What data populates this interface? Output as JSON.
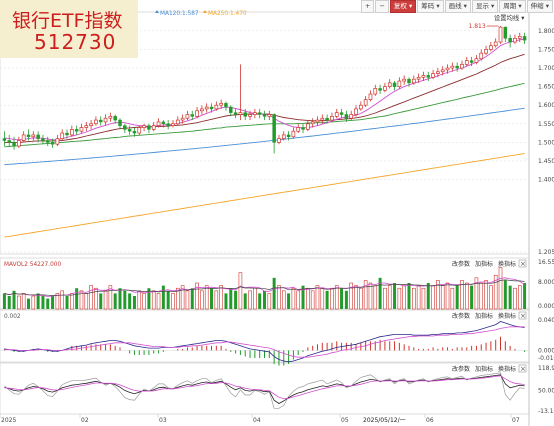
{
  "title": {
    "name": "银行ETF指数",
    "code": "512730"
  },
  "toolbar": [
    "+",
    "−",
    "复权",
    "筹码",
    "画线",
    "显示",
    "周期",
    "伸缩"
  ],
  "toolbar_active": 2,
  "settings_label": "设置均线",
  "ma_legend": [
    {
      "text": "1.644",
      "color": "#3c7ac4"
    },
    {
      "text": "MA120:1.587",
      "color": "#4a8fd6"
    },
    {
      "text": "MA250:1.470",
      "color": "#f5a52a"
    }
  ],
  "price_axis": [
    "1.800",
    "1.750",
    "1.700",
    "1.650",
    "1.600",
    "1.550",
    "1.500",
    "1.450",
    "1.400",
    "1.205"
  ],
  "high_marker": "1.813",
  "vol_title": "MAVOL2 54227.000",
  "vol_axis": [
    "16.555",
    "8.000",
    "0.000"
  ],
  "macd_title": "0.002",
  "macd_axis": [
    "0.040",
    "0.000",
    "-0.010"
  ],
  "kdj_axis": [
    "118.93",
    "50.00",
    "-13.160"
  ],
  "panel_buttons": [
    "改参数",
    "加指标",
    "换指标"
  ],
  "close_glyph": "×",
  "x_axis": [
    "2025",
    "02",
    "03",
    "04",
    "05",
    "2025/05/12/一",
    "06",
    "07"
  ],
  "colors": {
    "up": "#d0342c",
    "down": "#239a2c",
    "bg": "#ffffff"
  },
  "chart_data": {
    "type": "candlestick",
    "indicators": [
      "MA120",
      "MA250",
      "MAVOL2",
      "MACD",
      "KDJ"
    ],
    "ylim": [
      1.205,
      1.84
    ],
    "high_label": 1.813,
    "candles": [
      [
        1.51,
        1.505,
        1.53,
        1.49
      ],
      [
        1.505,
        1.5,
        1.52,
        1.49
      ],
      [
        1.5,
        1.49,
        1.515,
        1.48
      ],
      [
        1.49,
        1.505,
        1.515,
        1.485
      ],
      [
        1.505,
        1.52,
        1.53,
        1.5
      ],
      [
        1.52,
        1.515,
        1.535,
        1.505
      ],
      [
        1.515,
        1.52,
        1.53,
        1.505
      ],
      [
        1.52,
        1.51,
        1.53,
        1.5
      ],
      [
        1.51,
        1.505,
        1.52,
        1.495
      ],
      [
        1.505,
        1.5,
        1.515,
        1.49
      ],
      [
        1.5,
        1.495,
        1.51,
        1.485
      ],
      [
        1.495,
        1.51,
        1.52,
        1.49
      ],
      [
        1.51,
        1.525,
        1.535,
        1.505
      ],
      [
        1.525,
        1.52,
        1.535,
        1.51
      ],
      [
        1.52,
        1.535,
        1.545,
        1.515
      ],
      [
        1.535,
        1.53,
        1.545,
        1.52
      ],
      [
        1.53,
        1.54,
        1.55,
        1.525
      ],
      [
        1.54,
        1.545,
        1.555,
        1.53
      ],
      [
        1.545,
        1.55,
        1.56,
        1.535
      ],
      [
        1.55,
        1.56,
        1.57,
        1.545
      ],
      [
        1.56,
        1.555,
        1.57,
        1.545
      ],
      [
        1.555,
        1.565,
        1.575,
        1.545
      ],
      [
        1.565,
        1.57,
        1.58,
        1.555
      ],
      [
        1.57,
        1.56,
        1.575,
        1.55
      ],
      [
        1.56,
        1.545,
        1.565,
        1.535
      ],
      [
        1.545,
        1.535,
        1.55,
        1.525
      ],
      [
        1.535,
        1.53,
        1.545,
        1.52
      ],
      [
        1.53,
        1.525,
        1.54,
        1.515
      ],
      [
        1.525,
        1.54,
        1.545,
        1.52
      ],
      [
        1.54,
        1.545,
        1.55,
        1.53
      ],
      [
        1.545,
        1.535,
        1.55,
        1.525
      ],
      [
        1.535,
        1.545,
        1.555,
        1.53
      ],
      [
        1.545,
        1.555,
        1.565,
        1.54
      ],
      [
        1.555,
        1.55,
        1.56,
        1.54
      ],
      [
        1.55,
        1.545,
        1.56,
        1.535
      ],
      [
        1.545,
        1.55,
        1.56,
        1.54
      ],
      [
        1.55,
        1.56,
        1.57,
        1.545
      ],
      [
        1.56,
        1.565,
        1.575,
        1.55
      ],
      [
        1.565,
        1.575,
        1.585,
        1.56
      ],
      [
        1.575,
        1.57,
        1.585,
        1.56
      ],
      [
        1.57,
        1.585,
        1.595,
        1.565
      ],
      [
        1.585,
        1.59,
        1.6,
        1.575
      ],
      [
        1.59,
        1.595,
        1.605,
        1.58
      ],
      [
        1.595,
        1.59,
        1.605,
        1.58
      ],
      [
        1.59,
        1.6,
        1.61,
        1.585
      ],
      [
        1.6,
        1.605,
        1.615,
        1.59
      ],
      [
        1.605,
        1.595,
        1.61,
        1.585
      ],
      [
        1.595,
        1.58,
        1.6,
        1.57
      ],
      [
        1.58,
        1.575,
        1.59,
        1.565
      ],
      [
        1.575,
        1.58,
        1.71,
        1.56
      ],
      [
        1.58,
        1.57,
        1.59,
        1.56
      ],
      [
        1.57,
        1.575,
        1.585,
        1.56
      ],
      [
        1.575,
        1.58,
        1.59,
        1.565
      ],
      [
        1.58,
        1.575,
        1.59,
        1.565
      ],
      [
        1.575,
        1.57,
        1.585,
        1.56
      ],
      [
        1.57,
        1.575,
        1.585,
        1.56
      ],
      [
        1.575,
        1.5,
        1.578,
        1.47
      ],
      [
        1.5,
        1.51,
        1.52,
        1.495
      ],
      [
        1.51,
        1.52,
        1.53,
        1.505
      ],
      [
        1.52,
        1.515,
        1.53,
        1.505
      ],
      [
        1.515,
        1.53,
        1.54,
        1.51
      ],
      [
        1.53,
        1.54,
        1.55,
        1.525
      ],
      [
        1.54,
        1.535,
        1.55,
        1.525
      ],
      [
        1.535,
        1.55,
        1.56,
        1.53
      ],
      [
        1.55,
        1.555,
        1.565,
        1.54
      ],
      [
        1.555,
        1.56,
        1.57,
        1.545
      ],
      [
        1.56,
        1.565,
        1.575,
        1.55
      ],
      [
        1.565,
        1.56,
        1.575,
        1.55
      ],
      [
        1.56,
        1.57,
        1.58,
        1.555
      ],
      [
        1.57,
        1.58,
        1.59,
        1.565
      ],
      [
        1.58,
        1.575,
        1.59,
        1.565
      ],
      [
        1.575,
        1.565,
        1.585,
        1.555
      ],
      [
        1.565,
        1.575,
        1.585,
        1.56
      ],
      [
        1.575,
        1.59,
        1.6,
        1.57
      ],
      [
        1.59,
        1.6,
        1.61,
        1.585
      ],
      [
        1.6,
        1.615,
        1.625,
        1.595
      ],
      [
        1.615,
        1.63,
        1.64,
        1.61
      ],
      [
        1.63,
        1.645,
        1.655,
        1.625
      ],
      [
        1.645,
        1.64,
        1.655,
        1.63
      ],
      [
        1.64,
        1.65,
        1.66,
        1.635
      ],
      [
        1.65,
        1.66,
        1.67,
        1.645
      ],
      [
        1.66,
        1.65,
        1.665,
        1.64
      ],
      [
        1.65,
        1.665,
        1.675,
        1.645
      ],
      [
        1.665,
        1.67,
        1.68,
        1.655
      ],
      [
        1.67,
        1.66,
        1.675,
        1.65
      ],
      [
        1.66,
        1.67,
        1.68,
        1.655
      ],
      [
        1.67,
        1.675,
        1.685,
        1.66
      ],
      [
        1.675,
        1.68,
        1.69,
        1.665
      ],
      [
        1.68,
        1.675,
        1.69,
        1.665
      ],
      [
        1.675,
        1.685,
        1.695,
        1.67
      ],
      [
        1.685,
        1.69,
        1.7,
        1.675
      ],
      [
        1.69,
        1.695,
        1.705,
        1.68
      ],
      [
        1.695,
        1.7,
        1.71,
        1.685
      ],
      [
        1.7,
        1.705,
        1.715,
        1.69
      ],
      [
        1.705,
        1.7,
        1.715,
        1.69
      ],
      [
        1.7,
        1.71,
        1.72,
        1.695
      ],
      [
        1.71,
        1.72,
        1.73,
        1.705
      ],
      [
        1.72,
        1.715,
        1.73,
        1.705
      ],
      [
        1.715,
        1.725,
        1.735,
        1.71
      ],
      [
        1.725,
        1.74,
        1.75,
        1.72
      ],
      [
        1.74,
        1.75,
        1.76,
        1.735
      ],
      [
        1.75,
        1.76,
        1.77,
        1.745
      ],
      [
        1.76,
        1.77,
        1.78,
        1.755
      ],
      [
        1.77,
        1.81,
        1.813,
        1.765
      ],
      [
        1.81,
        1.78,
        1.812,
        1.77
      ],
      [
        1.78,
        1.77,
        1.79,
        1.755
      ],
      [
        1.77,
        1.78,
        1.79,
        1.765
      ],
      [
        1.78,
        1.785,
        1.795,
        1.77
      ],
      [
        1.785,
        1.775,
        1.795,
        1.765
      ]
    ],
    "ma_fast": [
      1.512,
      1.51,
      1.508,
      1.507,
      1.508,
      1.51,
      1.512,
      1.512,
      1.511,
      1.509,
      1.507,
      1.507,
      1.51,
      1.513,
      1.517,
      1.52,
      1.524,
      1.528,
      1.533,
      1.538,
      1.542,
      1.546,
      1.55,
      1.553,
      1.554,
      1.553,
      1.55,
      1.547,
      1.545,
      1.544,
      1.543,
      1.543,
      1.545,
      1.547,
      1.548,
      1.549,
      1.551,
      1.554,
      1.558,
      1.562,
      1.567,
      1.573,
      1.578,
      1.583,
      1.588,
      1.593,
      1.595,
      1.594,
      1.591,
      1.588,
      1.584,
      1.58,
      1.578,
      1.577,
      1.575,
      1.574,
      1.565,
      1.557,
      1.551,
      1.546,
      1.542,
      1.54,
      1.539,
      1.54,
      1.542,
      1.545,
      1.549,
      1.553,
      1.557,
      1.562,
      1.566,
      1.568,
      1.57,
      1.573,
      1.578,
      1.585,
      1.593,
      1.602,
      1.611,
      1.62,
      1.629,
      1.637,
      1.644,
      1.65,
      1.655,
      1.659,
      1.663,
      1.667,
      1.671,
      1.675,
      1.679,
      1.684,
      1.688,
      1.692,
      1.696,
      1.7,
      1.705,
      1.71,
      1.716,
      1.723,
      1.731,
      1.74,
      1.75,
      1.76,
      1.766,
      1.77,
      1.773,
      1.776,
      1.778
    ],
    "ma_mid": [
      1.5,
      1.5,
      1.5,
      1.5,
      1.501,
      1.502,
      1.503,
      1.504,
      1.504,
      1.504,
      1.504,
      1.504,
      1.505,
      1.507,
      1.509,
      1.511,
      1.514,
      1.517,
      1.52,
      1.523,
      1.526,
      1.529,
      1.532,
      1.535,
      1.537,
      1.538,
      1.539,
      1.54,
      1.541,
      1.541,
      1.542,
      1.542,
      1.543,
      1.543,
      1.544,
      1.545,
      1.546,
      1.547,
      1.549,
      1.551,
      1.553,
      1.556,
      1.559,
      1.562,
      1.565,
      1.568,
      1.571,
      1.573,
      1.574,
      1.575,
      1.576,
      1.576,
      1.576,
      1.576,
      1.576,
      1.576,
      1.573,
      1.57,
      1.567,
      1.565,
      1.563,
      1.561,
      1.56,
      1.559,
      1.558,
      1.558,
      1.558,
      1.559,
      1.56,
      1.561,
      1.562,
      1.563,
      1.564,
      1.566,
      1.568,
      1.571,
      1.575,
      1.579,
      1.584,
      1.589,
      1.594,
      1.599,
      1.604,
      1.609,
      1.614,
      1.619,
      1.624,
      1.629,
      1.634,
      1.639,
      1.644,
      1.649,
      1.654,
      1.659,
      1.664,
      1.669,
      1.674,
      1.679,
      1.684,
      1.69,
      1.696,
      1.702,
      1.708,
      1.715,
      1.72,
      1.725,
      1.729,
      1.733,
      1.737
    ],
    "ma_slow": [
      1.488,
      1.489,
      1.49,
      1.491,
      1.492,
      1.493,
      1.494,
      1.495,
      1.496,
      1.497,
      1.498,
      1.499,
      1.5,
      1.501,
      1.502,
      1.503,
      1.504,
      1.505,
      1.506,
      1.508,
      1.509,
      1.51,
      1.512,
      1.513,
      1.514,
      1.516,
      1.517,
      1.518,
      1.519,
      1.52,
      1.521,
      1.522,
      1.523,
      1.524,
      1.525,
      1.526,
      1.527,
      1.528,
      1.529,
      1.53,
      1.532,
      1.533,
      1.535,
      1.536,
      1.538,
      1.539,
      1.541,
      1.542,
      1.543,
      1.544,
      1.545,
      1.546,
      1.547,
      1.548,
      1.549,
      1.55,
      1.55,
      1.55,
      1.55,
      1.55,
      1.55,
      1.551,
      1.551,
      1.552,
      1.552,
      1.553,
      1.553,
      1.554,
      1.555,
      1.556,
      1.557,
      1.558,
      1.559,
      1.56,
      1.561,
      1.563,
      1.565,
      1.567,
      1.569,
      1.571,
      1.574,
      1.577,
      1.58,
      1.583,
      1.586,
      1.589,
      1.592,
      1.595,
      1.598,
      1.601,
      1.604,
      1.607,
      1.61,
      1.613,
      1.616,
      1.619,
      1.622,
      1.625,
      1.628,
      1.631,
      1.634,
      1.637,
      1.64,
      1.644,
      1.647,
      1.65,
      1.653,
      1.656,
      1.659
    ],
    "ma120_range": [
      1.44,
      1.592
    ],
    "ma250_range": [
      1.245,
      1.47
    ],
    "volumes": [
      6,
      5,
      7,
      5,
      6,
      4,
      5,
      6,
      5,
      4,
      5,
      6,
      7,
      5,
      6,
      8,
      7,
      6,
      9,
      8,
      6,
      7,
      9,
      6,
      8,
      7,
      6,
      5,
      7,
      6,
      8,
      7,
      6,
      9,
      7,
      6,
      8,
      9,
      7,
      8,
      10,
      7,
      9,
      8,
      7,
      9,
      6,
      8,
      7,
      14,
      6,
      7,
      8,
      6,
      7,
      6,
      12,
      9,
      7,
      6,
      8,
      7,
      9,
      8,
      7,
      9,
      8,
      7,
      8,
      9,
      8,
      7,
      10,
      9,
      8,
      11,
      10,
      9,
      12,
      8,
      9,
      10,
      8,
      9,
      10,
      8,
      9,
      8,
      10,
      9,
      11,
      9,
      10,
      8,
      9,
      11,
      10,
      9,
      12,
      10,
      11,
      9,
      13,
      16,
      11,
      9,
      8,
      9,
      10
    ],
    "dif": [
      0.002,
      0.001,
      0.0,
      -0.001,
      -0.001,
      0.0,
      0.001,
      0.002,
      0.001,
      0.0,
      -0.001,
      -0.001,
      0.0,
      0.002,
      0.004,
      0.005,
      0.006,
      0.007,
      0.009,
      0.01,
      0.011,
      0.012,
      0.013,
      0.013,
      0.012,
      0.01,
      0.008,
      0.006,
      0.005,
      0.004,
      0.003,
      0.003,
      0.003,
      0.004,
      0.004,
      0.004,
      0.005,
      0.006,
      0.007,
      0.008,
      0.009,
      0.01,
      0.011,
      0.012,
      0.013,
      0.013,
      0.012,
      0.01,
      0.008,
      0.006,
      0.004,
      0.002,
      0.001,
      0.0,
      -0.001,
      -0.002,
      -0.008,
      -0.012,
      -0.014,
      -0.015,
      -0.014,
      -0.012,
      -0.01,
      -0.007,
      -0.005,
      -0.003,
      -0.001,
      0.0,
      0.002,
      0.004,
      0.005,
      0.006,
      0.007,
      0.008,
      0.01,
      0.012,
      0.014,
      0.016,
      0.018,
      0.019,
      0.02,
      0.021,
      0.021,
      0.021,
      0.021,
      0.02,
      0.02,
      0.02,
      0.02,
      0.021,
      0.021,
      0.022,
      0.022,
      0.022,
      0.023,
      0.023,
      0.024,
      0.025,
      0.026,
      0.028,
      0.03,
      0.032,
      0.034,
      0.038,
      0.036,
      0.034,
      0.032,
      0.031,
      0.03
    ],
    "dea": [
      0.001,
      0.001,
      0.001,
      0.0,
      0.0,
      0.0,
      0.0,
      0.001,
      0.001,
      0.001,
      0.0,
      0.0,
      0.0,
      0.001,
      0.001,
      0.002,
      0.003,
      0.004,
      0.005,
      0.006,
      0.007,
      0.008,
      0.009,
      0.01,
      0.01,
      0.01,
      0.01,
      0.009,
      0.008,
      0.007,
      0.006,
      0.005,
      0.005,
      0.005,
      0.004,
      0.004,
      0.004,
      0.005,
      0.005,
      0.006,
      0.006,
      0.007,
      0.008,
      0.009,
      0.01,
      0.01,
      0.011,
      0.011,
      0.01,
      0.009,
      0.008,
      0.007,
      0.006,
      0.005,
      0.004,
      0.003,
      0.001,
      -0.002,
      -0.004,
      -0.006,
      -0.008,
      -0.009,
      -0.009,
      -0.009,
      -0.008,
      -0.007,
      -0.006,
      -0.005,
      -0.003,
      -0.002,
      0.0,
      0.001,
      0.002,
      0.004,
      0.005,
      0.006,
      0.008,
      0.01,
      0.011,
      0.013,
      0.014,
      0.015,
      0.016,
      0.017,
      0.018,
      0.018,
      0.019,
      0.019,
      0.019,
      0.019,
      0.02,
      0.02,
      0.02,
      0.021,
      0.021,
      0.021,
      0.022,
      0.022,
      0.023,
      0.024,
      0.025,
      0.026,
      0.027,
      0.029,
      0.03,
      0.031,
      0.031,
      0.031,
      0.031
    ],
    "k": [
      60,
      55,
      50,
      48,
      52,
      58,
      62,
      60,
      55,
      48,
      45,
      50,
      58,
      62,
      66,
      68,
      70,
      72,
      75,
      78,
      74,
      70,
      72,
      68,
      60,
      50,
      44,
      40,
      45,
      50,
      48,
      52,
      58,
      60,
      56,
      55,
      60,
      64,
      68,
      66,
      70,
      74,
      76,
      72,
      75,
      78,
      70,
      60,
      52,
      58,
      50,
      48,
      52,
      50,
      46,
      48,
      20,
      10,
      18,
      28,
      36,
      42,
      46,
      52,
      56,
      60,
      64,
      62,
      66,
      70,
      68,
      62,
      64,
      70,
      76,
      80,
      84,
      82,
      78,
      80,
      82,
      76,
      80,
      82,
      76,
      78,
      80,
      82,
      78,
      80,
      82,
      84,
      86,
      84,
      86,
      88,
      84,
      86,
      88,
      90,
      92,
      94,
      96,
      98,
      70,
      58,
      62,
      66,
      64
    ],
    "d": [
      58,
      57,
      55,
      53,
      52,
      54,
      57,
      59,
      58,
      55,
      52,
      51,
      53,
      56,
      59,
      62,
      65,
      67,
      70,
      73,
      73,
      72,
      72,
      71,
      67,
      61,
      55,
      50,
      48,
      48,
      48,
      49,
      52,
      55,
      55,
      55,
      57,
      59,
      62,
      63,
      65,
      68,
      71,
      71,
      72,
      74,
      73,
      69,
      63,
      61,
      57,
      54,
      53,
      52,
      50,
      49,
      39,
      29,
      25,
      26,
      30,
      34,
      38,
      43,
      47,
      51,
      55,
      58,
      61,
      64,
      65,
      64,
      64,
      66,
      69,
      73,
      77,
      79,
      79,
      79,
      80,
      79,
      79,
      80,
      79,
      79,
      79,
      80,
      79,
      79,
      80,
      81,
      83,
      83,
      84,
      85,
      85,
      85,
      86,
      87,
      89,
      91,
      93,
      95,
      86,
      77,
      72,
      70,
      68
    ]
  }
}
